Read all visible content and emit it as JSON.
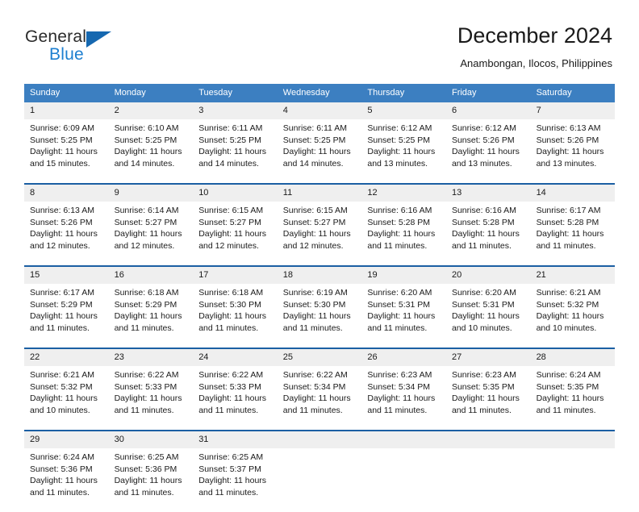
{
  "brand": {
    "name_top": "General",
    "name_bottom": "Blue",
    "accent_color": "#1668b0",
    "text_color": "#2b2b2b"
  },
  "header": {
    "title": "December 2024",
    "subtitle": "Anambongan, Ilocos, Philippines"
  },
  "theme": {
    "header_bg": "#3c7fc1",
    "row_separator": "#1b5fa3",
    "daynum_bg": "#efefef",
    "cell_bg": "#ffffff"
  },
  "weekday_headers": [
    "Sunday",
    "Monday",
    "Tuesday",
    "Wednesday",
    "Thursday",
    "Friday",
    "Saturday"
  ],
  "weeks": [
    {
      "days": [
        {
          "num": "1",
          "sunrise": "Sunrise: 6:09 AM",
          "sunset": "Sunset: 5:25 PM",
          "daylight": "Daylight: 11 hours and 15 minutes."
        },
        {
          "num": "2",
          "sunrise": "Sunrise: 6:10 AM",
          "sunset": "Sunset: 5:25 PM",
          "daylight": "Daylight: 11 hours and 14 minutes."
        },
        {
          "num": "3",
          "sunrise": "Sunrise: 6:11 AM",
          "sunset": "Sunset: 5:25 PM",
          "daylight": "Daylight: 11 hours and 14 minutes."
        },
        {
          "num": "4",
          "sunrise": "Sunrise: 6:11 AM",
          "sunset": "Sunset: 5:25 PM",
          "daylight": "Daylight: 11 hours and 14 minutes."
        },
        {
          "num": "5",
          "sunrise": "Sunrise: 6:12 AM",
          "sunset": "Sunset: 5:25 PM",
          "daylight": "Daylight: 11 hours and 13 minutes."
        },
        {
          "num": "6",
          "sunrise": "Sunrise: 6:12 AM",
          "sunset": "Sunset: 5:26 PM",
          "daylight": "Daylight: 11 hours and 13 minutes."
        },
        {
          "num": "7",
          "sunrise": "Sunrise: 6:13 AM",
          "sunset": "Sunset: 5:26 PM",
          "daylight": "Daylight: 11 hours and 13 minutes."
        }
      ]
    },
    {
      "days": [
        {
          "num": "8",
          "sunrise": "Sunrise: 6:13 AM",
          "sunset": "Sunset: 5:26 PM",
          "daylight": "Daylight: 11 hours and 12 minutes."
        },
        {
          "num": "9",
          "sunrise": "Sunrise: 6:14 AM",
          "sunset": "Sunset: 5:27 PM",
          "daylight": "Daylight: 11 hours and 12 minutes."
        },
        {
          "num": "10",
          "sunrise": "Sunrise: 6:15 AM",
          "sunset": "Sunset: 5:27 PM",
          "daylight": "Daylight: 11 hours and 12 minutes."
        },
        {
          "num": "11",
          "sunrise": "Sunrise: 6:15 AM",
          "sunset": "Sunset: 5:27 PM",
          "daylight": "Daylight: 11 hours and 12 minutes."
        },
        {
          "num": "12",
          "sunrise": "Sunrise: 6:16 AM",
          "sunset": "Sunset: 5:28 PM",
          "daylight": "Daylight: 11 hours and 11 minutes."
        },
        {
          "num": "13",
          "sunrise": "Sunrise: 6:16 AM",
          "sunset": "Sunset: 5:28 PM",
          "daylight": "Daylight: 11 hours and 11 minutes."
        },
        {
          "num": "14",
          "sunrise": "Sunrise: 6:17 AM",
          "sunset": "Sunset: 5:28 PM",
          "daylight": "Daylight: 11 hours and 11 minutes."
        }
      ]
    },
    {
      "days": [
        {
          "num": "15",
          "sunrise": "Sunrise: 6:17 AM",
          "sunset": "Sunset: 5:29 PM",
          "daylight": "Daylight: 11 hours and 11 minutes."
        },
        {
          "num": "16",
          "sunrise": "Sunrise: 6:18 AM",
          "sunset": "Sunset: 5:29 PM",
          "daylight": "Daylight: 11 hours and 11 minutes."
        },
        {
          "num": "17",
          "sunrise": "Sunrise: 6:18 AM",
          "sunset": "Sunset: 5:30 PM",
          "daylight": "Daylight: 11 hours and 11 minutes."
        },
        {
          "num": "18",
          "sunrise": "Sunrise: 6:19 AM",
          "sunset": "Sunset: 5:30 PM",
          "daylight": "Daylight: 11 hours and 11 minutes."
        },
        {
          "num": "19",
          "sunrise": "Sunrise: 6:20 AM",
          "sunset": "Sunset: 5:31 PM",
          "daylight": "Daylight: 11 hours and 11 minutes."
        },
        {
          "num": "20",
          "sunrise": "Sunrise: 6:20 AM",
          "sunset": "Sunset: 5:31 PM",
          "daylight": "Daylight: 11 hours and 10 minutes."
        },
        {
          "num": "21",
          "sunrise": "Sunrise: 6:21 AM",
          "sunset": "Sunset: 5:32 PM",
          "daylight": "Daylight: 11 hours and 10 minutes."
        }
      ]
    },
    {
      "days": [
        {
          "num": "22",
          "sunrise": "Sunrise: 6:21 AM",
          "sunset": "Sunset: 5:32 PM",
          "daylight": "Daylight: 11 hours and 10 minutes."
        },
        {
          "num": "23",
          "sunrise": "Sunrise: 6:22 AM",
          "sunset": "Sunset: 5:33 PM",
          "daylight": "Daylight: 11 hours and 11 minutes."
        },
        {
          "num": "24",
          "sunrise": "Sunrise: 6:22 AM",
          "sunset": "Sunset: 5:33 PM",
          "daylight": "Daylight: 11 hours and 11 minutes."
        },
        {
          "num": "25",
          "sunrise": "Sunrise: 6:22 AM",
          "sunset": "Sunset: 5:34 PM",
          "daylight": "Daylight: 11 hours and 11 minutes."
        },
        {
          "num": "26",
          "sunrise": "Sunrise: 6:23 AM",
          "sunset": "Sunset: 5:34 PM",
          "daylight": "Daylight: 11 hours and 11 minutes."
        },
        {
          "num": "27",
          "sunrise": "Sunrise: 6:23 AM",
          "sunset": "Sunset: 5:35 PM",
          "daylight": "Daylight: 11 hours and 11 minutes."
        },
        {
          "num": "28",
          "sunrise": "Sunrise: 6:24 AM",
          "sunset": "Sunset: 5:35 PM",
          "daylight": "Daylight: 11 hours and 11 minutes."
        }
      ]
    },
    {
      "days": [
        {
          "num": "29",
          "sunrise": "Sunrise: 6:24 AM",
          "sunset": "Sunset: 5:36 PM",
          "daylight": "Daylight: 11 hours and 11 minutes."
        },
        {
          "num": "30",
          "sunrise": "Sunrise: 6:25 AM",
          "sunset": "Sunset: 5:36 PM",
          "daylight": "Daylight: 11 hours and 11 minutes."
        },
        {
          "num": "31",
          "sunrise": "Sunrise: 6:25 AM",
          "sunset": "Sunset: 5:37 PM",
          "daylight": "Daylight: 11 hours and 11 minutes."
        },
        {
          "num": "",
          "sunrise": "",
          "sunset": "",
          "daylight": ""
        },
        {
          "num": "",
          "sunrise": "",
          "sunset": "",
          "daylight": ""
        },
        {
          "num": "",
          "sunrise": "",
          "sunset": "",
          "daylight": ""
        },
        {
          "num": "",
          "sunrise": "",
          "sunset": "",
          "daylight": ""
        }
      ]
    }
  ]
}
